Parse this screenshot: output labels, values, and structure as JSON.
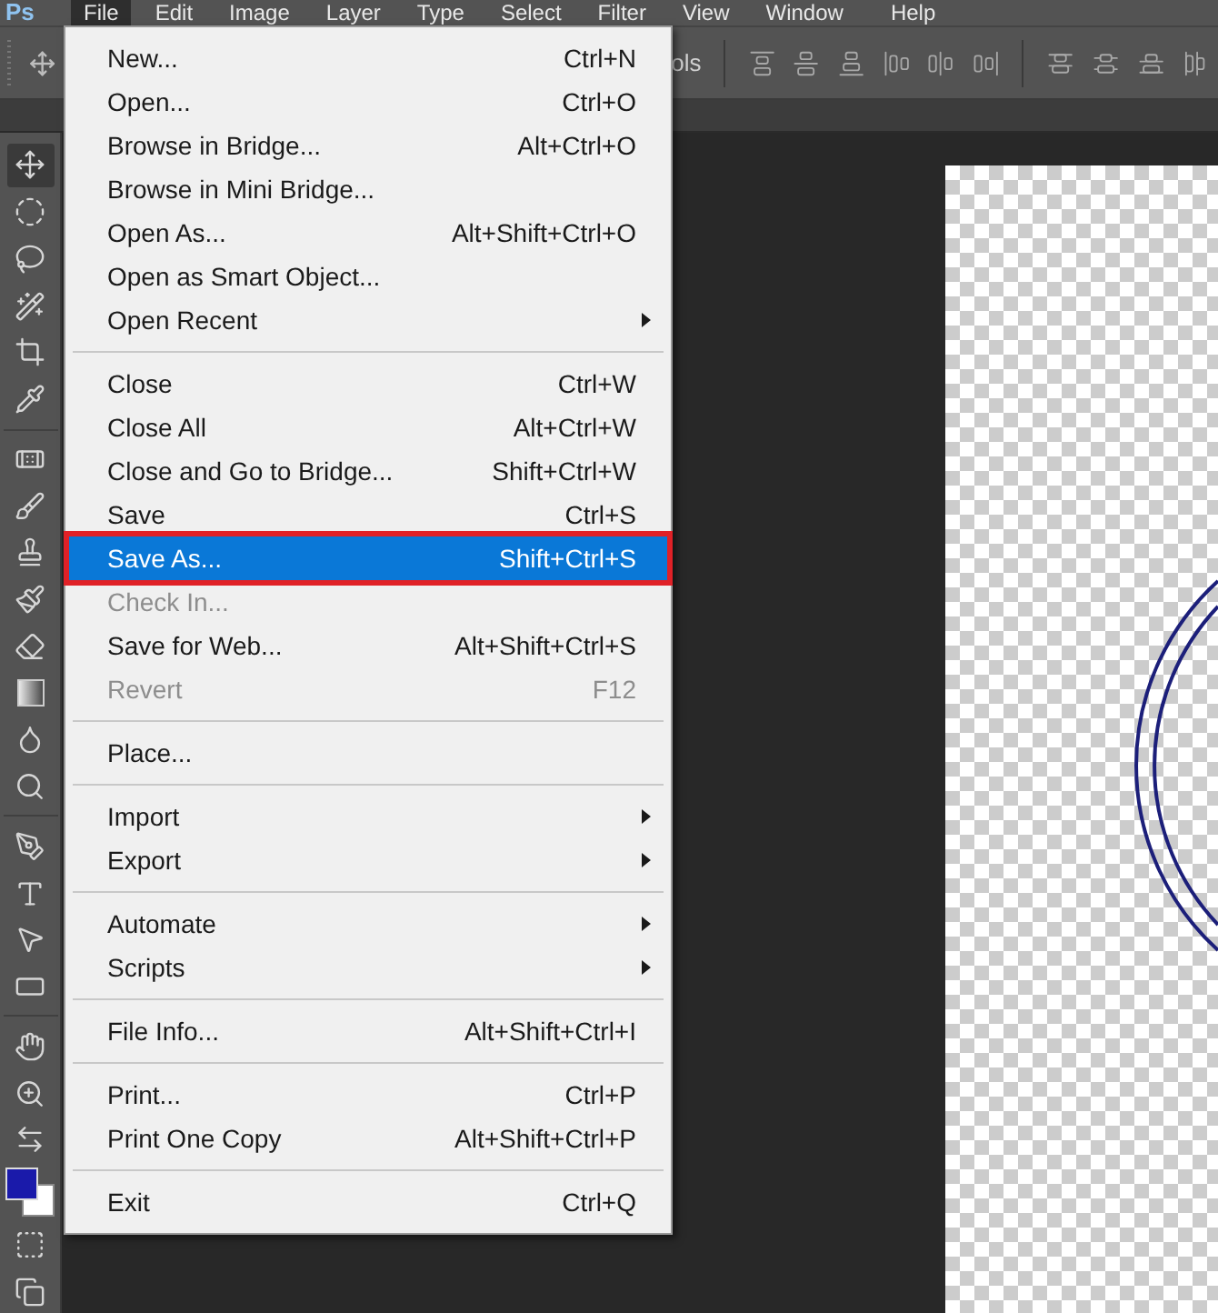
{
  "app_logo": "Ps",
  "menubar": [
    {
      "label": "File",
      "selected": true
    },
    {
      "label": "Edit",
      "selected": false
    },
    {
      "label": "Image",
      "selected": false
    },
    {
      "label": "Layer",
      "selected": false
    },
    {
      "label": "Type",
      "selected": false
    },
    {
      "label": "Select",
      "selected": false
    },
    {
      "label": "Filter",
      "selected": false
    },
    {
      "label": "View",
      "selected": false
    },
    {
      "label": "Window",
      "selected": false
    },
    {
      "label": "Help",
      "selected": false
    }
  ],
  "options_bar": {
    "text": "ols"
  },
  "file_menu": {
    "groups": [
      {
        "items": [
          {
            "label": "New...",
            "shortcut": "Ctrl+N",
            "submenu": false,
            "disabled": false,
            "selected": false,
            "highlighted": false
          },
          {
            "label": "Open...",
            "shortcut": "Ctrl+O",
            "submenu": false,
            "disabled": false,
            "selected": false,
            "highlighted": false
          },
          {
            "label": "Browse in Bridge...",
            "shortcut": "Alt+Ctrl+O",
            "submenu": false,
            "disabled": false,
            "selected": false,
            "highlighted": false
          },
          {
            "label": "Browse in Mini Bridge...",
            "submenu": false,
            "disabled": false,
            "selected": false,
            "highlighted": false
          },
          {
            "label": "Open As...",
            "shortcut": "Alt+Shift+Ctrl+O",
            "submenu": false,
            "disabled": false,
            "selected": false,
            "highlighted": false
          },
          {
            "label": "Open as Smart Object...",
            "submenu": false,
            "disabled": false,
            "selected": false,
            "highlighted": false
          },
          {
            "label": "Open Recent",
            "submenu": true,
            "disabled": false,
            "selected": false,
            "highlighted": false
          }
        ]
      },
      {
        "items": [
          {
            "label": "Close",
            "shortcut": "Ctrl+W",
            "submenu": false,
            "disabled": false,
            "selected": false,
            "highlighted": false
          },
          {
            "label": "Close All",
            "shortcut": "Alt+Ctrl+W",
            "submenu": false,
            "disabled": false,
            "selected": false,
            "highlighted": false
          },
          {
            "label": "Close and Go to Bridge...",
            "shortcut": "Shift+Ctrl+W",
            "submenu": false,
            "disabled": false,
            "selected": false,
            "highlighted": false
          },
          {
            "label": "Save",
            "shortcut": "Ctrl+S",
            "submenu": false,
            "disabled": false,
            "selected": false,
            "highlighted": false
          },
          {
            "label": "Save As...",
            "shortcut": "Shift+Ctrl+S",
            "submenu": false,
            "disabled": false,
            "selected": true,
            "highlighted": true
          },
          {
            "label": "Check In...",
            "submenu": false,
            "disabled": true,
            "selected": false,
            "highlighted": false
          },
          {
            "label": "Save for Web...",
            "shortcut": "Alt+Shift+Ctrl+S",
            "submenu": false,
            "disabled": false,
            "selected": false,
            "highlighted": false
          },
          {
            "label": "Revert",
            "shortcut": "F12",
            "submenu": false,
            "disabled": true,
            "selected": false,
            "highlighted": false
          }
        ]
      },
      {
        "items": [
          {
            "label": "Place...",
            "submenu": false,
            "disabled": false,
            "selected": false,
            "highlighted": false
          }
        ]
      },
      {
        "items": [
          {
            "label": "Import",
            "submenu": true,
            "disabled": false,
            "selected": false,
            "highlighted": false
          },
          {
            "label": "Export",
            "submenu": true,
            "disabled": false,
            "selected": false,
            "highlighted": false
          }
        ]
      },
      {
        "items": [
          {
            "label": "Automate",
            "submenu": true,
            "disabled": false,
            "selected": false,
            "highlighted": false
          },
          {
            "label": "Scripts",
            "submenu": true,
            "disabled": false,
            "selected": false,
            "highlighted": false
          }
        ]
      },
      {
        "items": [
          {
            "label": "File Info...",
            "shortcut": "Alt+Shift+Ctrl+I",
            "submenu": false,
            "disabled": false,
            "selected": false,
            "highlighted": false
          }
        ]
      },
      {
        "items": [
          {
            "label": "Print...",
            "shortcut": "Ctrl+P",
            "submenu": false,
            "disabled": false,
            "selected": false,
            "highlighted": false
          },
          {
            "label": "Print One Copy",
            "shortcut": "Alt+Shift+Ctrl+P",
            "submenu": false,
            "disabled": false,
            "selected": false,
            "highlighted": false
          }
        ]
      },
      {
        "items": [
          {
            "label": "Exit",
            "shortcut": "Ctrl+Q",
            "submenu": false,
            "disabled": false,
            "selected": false,
            "highlighted": false
          }
        ]
      }
    ]
  }
}
